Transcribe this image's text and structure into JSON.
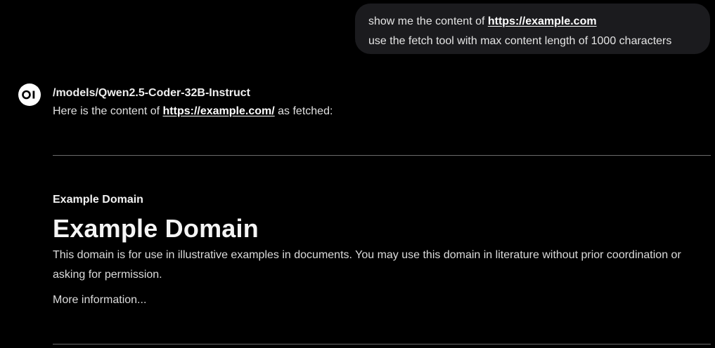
{
  "user_message": {
    "line1_prefix": "show me the content of ",
    "line1_link": "https://example.com",
    "line2": "use the fetch tool with max content length of 1000 characters"
  },
  "assistant": {
    "avatar_icon": "openwebui-logo-icon",
    "model_name": "/models/Qwen2.5-Coder-32B-Instruct",
    "intro_prefix": "Here is the content of ",
    "intro_link": "https://example.com/",
    "intro_suffix": " as fetched:"
  },
  "fetched_content": {
    "subtitle": "Example Domain",
    "heading": "Example Domain",
    "paragraph": "This domain is for use in illustrative examples in documents. You may use this domain in literature without prior coordination or asking for permission.",
    "more_info": "More information..."
  }
}
